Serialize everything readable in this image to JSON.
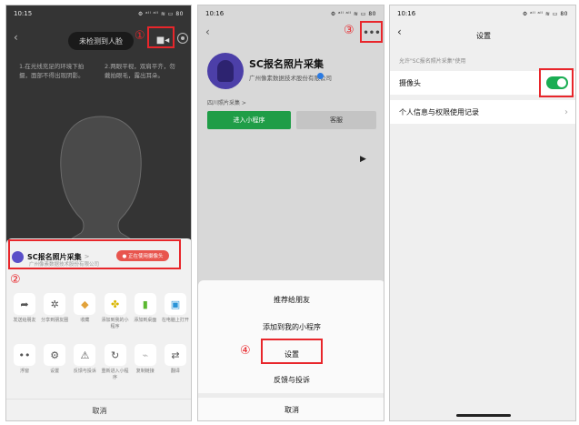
{
  "phone1": {
    "status_time": "10:15",
    "status_icons": "⚙ ᵃᴵˡ ᵃᴵˡ ≋ ▭ 80",
    "pill_text": "未检测到人脸",
    "tip_left": "1.在光线充足的环境下拍摄，面部不得出现阴影。",
    "tip_right": "2.两眼平视，双肩平齐，勿戴拍眼毛，露出耳朵。",
    "step1": "①",
    "step2": "②",
    "app_name": "SC报名照片采集",
    "app_arrow": ">",
    "company": "广州像素数据技术股份有限公司",
    "using_badge": "● 正在使用摄像头",
    "row1": [
      {
        "icon": "➦",
        "label": "发送给朋友"
      },
      {
        "icon": "✲",
        "label": "分享到朋友圈"
      },
      {
        "icon": "◆",
        "label": "收藏"
      },
      {
        "icon": "✤",
        "label": "添加到我的小程序"
      },
      {
        "icon": "▮",
        "label": "添加到桌面"
      },
      {
        "icon": "▣",
        "label": "在电脑上打开"
      }
    ],
    "row2": [
      {
        "icon": "••",
        "label": "浮窗"
      },
      {
        "icon": "⚙",
        "label": "设置"
      },
      {
        "icon": "⚠",
        "label": "反馈与投诉"
      },
      {
        "icon": "↻",
        "label": "重新进入小程序"
      },
      {
        "icon": "⌁",
        "label": "复制链接"
      },
      {
        "icon": "⇄",
        "label": "翻译"
      }
    ],
    "cancel": "取消"
  },
  "phone2": {
    "status_time": "10:16",
    "status_icons": "⚙ ᵃᴵˡ ᵃᴵˡ ≋ ▭ 80",
    "step3": "③",
    "more": "•••",
    "program_name": "SC报名照片采集",
    "company": "广州像素数据技术股份有限公司",
    "tag": "四川照片采集 >",
    "enter_label": "进入小程序",
    "cs_label": "客服",
    "menu": [
      "推荐给朋友",
      "添加到我的小程序",
      "设置",
      "反馈与投诉",
      "取消"
    ],
    "step4": "④"
  },
  "phone3": {
    "status_time": "10:16",
    "status_icons": "⚙ ᵃᴵˡ ᵃᴵˡ ≋ ▭ 80",
    "title": "设置",
    "section_label": "允许\"SC报名照片采集\"使用",
    "camera_label": "摄像头",
    "camera_enabled": true,
    "privacy_label": "个人信息与权限使用记录"
  }
}
